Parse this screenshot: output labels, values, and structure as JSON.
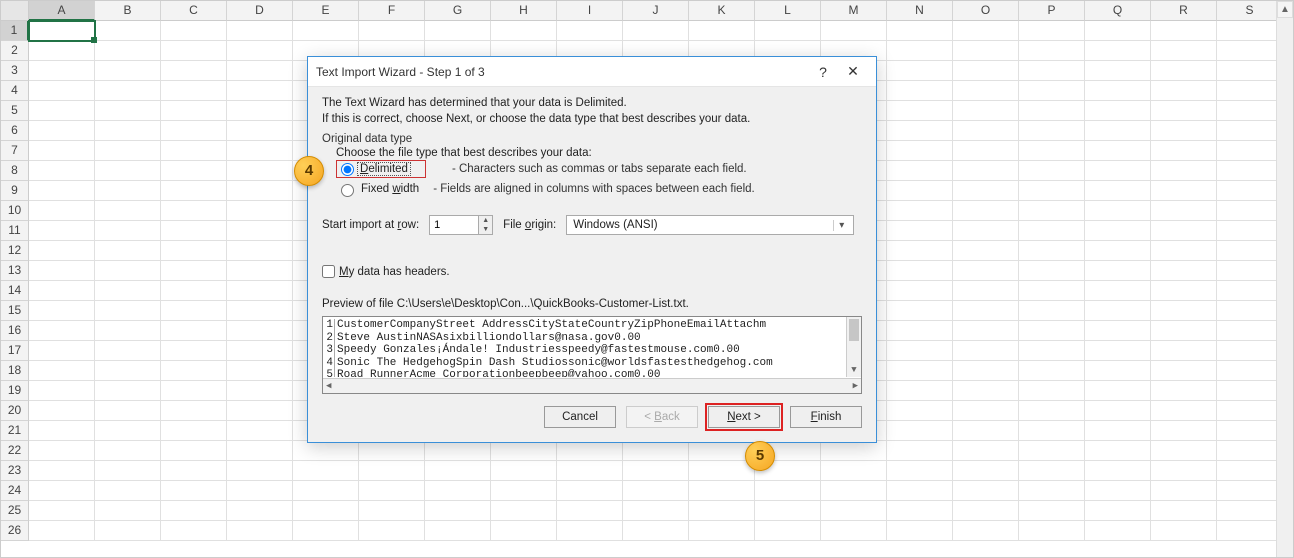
{
  "sheet": {
    "columns": [
      "A",
      "B",
      "C",
      "D",
      "E",
      "F",
      "G",
      "H",
      "I",
      "J",
      "K",
      "L",
      "M",
      "N",
      "O",
      "P",
      "Q",
      "R",
      "S"
    ],
    "rows": [
      1,
      2,
      3,
      4,
      5,
      6,
      7,
      8,
      9,
      10,
      11,
      12,
      13,
      14,
      15,
      16,
      17,
      18,
      19,
      20,
      21,
      22,
      23,
      24,
      25,
      26
    ],
    "active_cell": {
      "col": "A",
      "row": 1
    }
  },
  "dialog": {
    "title": "Text Import Wizard - Step 1 of 3",
    "help": "?",
    "close": "✕",
    "intro_line1": "The Text Wizard has determined that your data is Delimited.",
    "intro_line2": "If this is correct, choose Next, or choose the data type that best describes your data.",
    "group_label": "Original data type",
    "group_subtext": "Choose the file type that best describes your data:",
    "radio_delimited": {
      "label": "Delimited",
      "checked": true,
      "desc": "- Characters such as commas or tabs separate each field."
    },
    "radio_fixed": {
      "label": "Fixed width",
      "checked": false,
      "desc": "- Fields are aligned in columns with spaces between each field."
    },
    "start_row_label": "Start import at row:",
    "start_row_value": "1",
    "file_origin_label": "File origin:",
    "file_origin_value": "Windows (ANSI)",
    "headers_checkbox": {
      "label": "My data has headers.",
      "checked": false
    },
    "preview_label": "Preview of file C:\\Users\\e\\Desktop\\Con...\\QuickBooks-Customer-List.txt.",
    "preview_lines": [
      {
        "n": "1",
        "text": "CustomerCompanyStreet AddressCityStateCountryZipPhoneEmailAttachm"
      },
      {
        "n": "2",
        "text": "Steve AustinNASAsixbilliondollars@nasa.gov0.00"
      },
      {
        "n": "3",
        "text": "Speedy Gonzales¡Ándale! Industriesspeedy@fastestmouse.com0.00"
      },
      {
        "n": "4",
        "text": "Sonic The HedgehogSpin Dash Studiossonic@worldsfastesthedgehog.com"
      },
      {
        "n": "5",
        "text": "Road RunnerAcme Corporationbeepbeep@yahoo.com0.00"
      }
    ],
    "buttons": {
      "cancel": "Cancel",
      "back": "< Back",
      "next": "Next >",
      "finish": "Finish"
    }
  },
  "callouts": {
    "badge4": "4",
    "badge5": "5"
  }
}
